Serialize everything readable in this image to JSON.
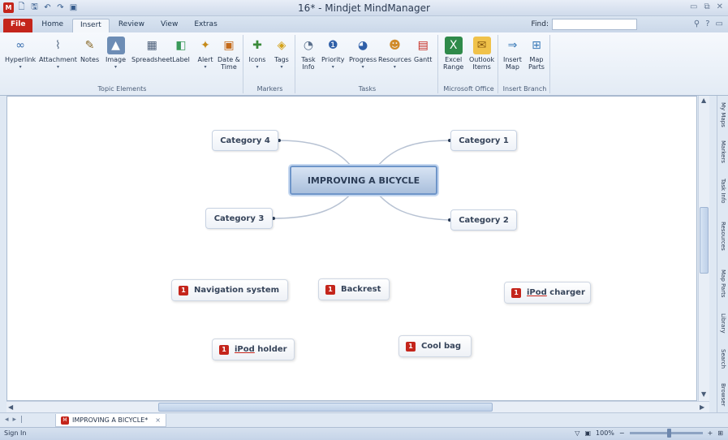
{
  "window": {
    "title": "16* - Mindjet MindManager",
    "controls": [
      "▭",
      "⧉",
      "✕"
    ]
  },
  "quick_access": [
    "M",
    "🗋",
    "🖫",
    "↶",
    "↷",
    "▣"
  ],
  "tabs": [
    {
      "label": "File"
    },
    {
      "label": "Home"
    },
    {
      "label": "Insert"
    },
    {
      "label": "Review"
    },
    {
      "label": "View"
    },
    {
      "label": "Extras"
    }
  ],
  "find": {
    "label": "Find:",
    "value": ""
  },
  "ribbon": {
    "groups": {
      "topic_elements": "Topic Elements",
      "markers": "Markers",
      "tasks": "Tasks",
      "microsoft_office": "Microsoft Office",
      "insert_branch": "Insert Branch"
    },
    "buttons": {
      "hyperlink": "Hyperlink",
      "attachment": "Attachment",
      "notes": "Notes",
      "image": "Image",
      "spreadsheet": "Spreadsheet",
      "label": "Label",
      "alert": "Alert",
      "date_time": "Date &",
      "date_time_2": "Time",
      "icons": "Icons",
      "tags": "Tags",
      "task_info": "Task",
      "task_info_2": "Info",
      "priority": "Priority",
      "progress": "Progress",
      "resources": "Resources",
      "gantt": "Gantt",
      "excel_range": "Excel",
      "excel_range_2": "Range",
      "outlook_items": "Outlook",
      "outlook_items_2": "Items",
      "insert_map": "Insert",
      "insert_map_2": "Map",
      "map_parts": "Map",
      "map_parts_2": "Parts"
    }
  },
  "mindmap": {
    "central": "IMPROVING A BICYCLE",
    "categories": {
      "c1": "Category 1",
      "c2": "Category 2",
      "c3": "Category 3",
      "c4": "Category 4"
    },
    "floating": {
      "nav": {
        "priority": "1",
        "label": "Navigation system"
      },
      "backrest": {
        "priority": "1",
        "label": "Backrest"
      },
      "ipod_charger": {
        "priority": "1",
        "label_a": "iPod",
        "label_b": " charger"
      },
      "ipod_holder": {
        "priority": "1",
        "label_a": "iPod",
        "label_b": " holder"
      },
      "coolbag": {
        "priority": "1",
        "label": "Cool bag"
      }
    }
  },
  "side_tabs": [
    "My Maps",
    "Markers",
    "Task Info",
    "Resources",
    "Map Parts",
    "Library",
    "Search",
    "Browser"
  ],
  "document_tab": {
    "label": "IMPROVING A BICYCLE*",
    "close": "×"
  },
  "status": {
    "sign_in": "Sign In",
    "zoom": "100%"
  }
}
